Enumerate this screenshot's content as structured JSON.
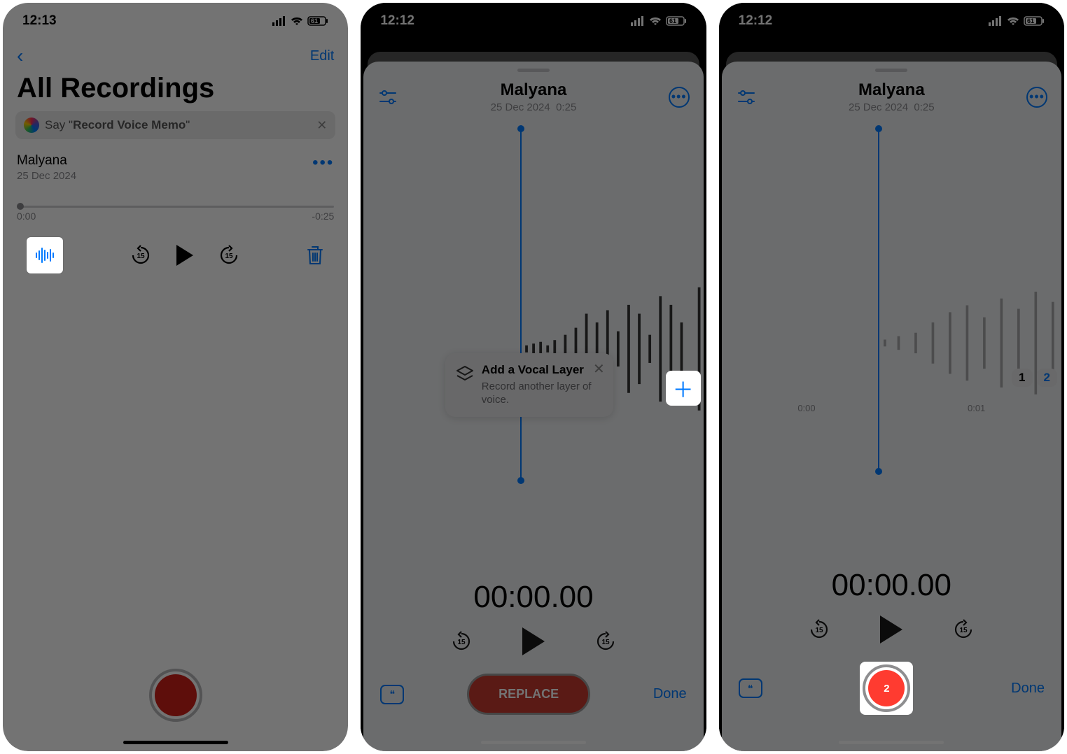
{
  "status": {
    "time1": "12:13",
    "time2": "12:12",
    "time3": "12:12",
    "battery": "61"
  },
  "screen1": {
    "edit": "Edit",
    "title": "All Recordings",
    "siri_prefix": "Say \"",
    "siri_cmd": "Record Voice Memo",
    "siri_suffix": "\"",
    "memo_name": "Malyana",
    "memo_date": "25 Dec 2024",
    "time_start": "0:00",
    "time_end": "-0:25"
  },
  "editor": {
    "title": "Malyana",
    "subtitle_date": "25 Dec 2024",
    "subtitle_dur": "0:25",
    "timer": "00:00.00",
    "replace": "REPLACE",
    "done": "Done",
    "skip_secs": "15"
  },
  "tip": {
    "title": "Add a Vocal Layer",
    "desc": "Record another layer of voice."
  },
  "layers": {
    "one": "1",
    "two": "2",
    "ruler_a": "0:00",
    "ruler_b": "0:01",
    "rec_badge": "2"
  }
}
